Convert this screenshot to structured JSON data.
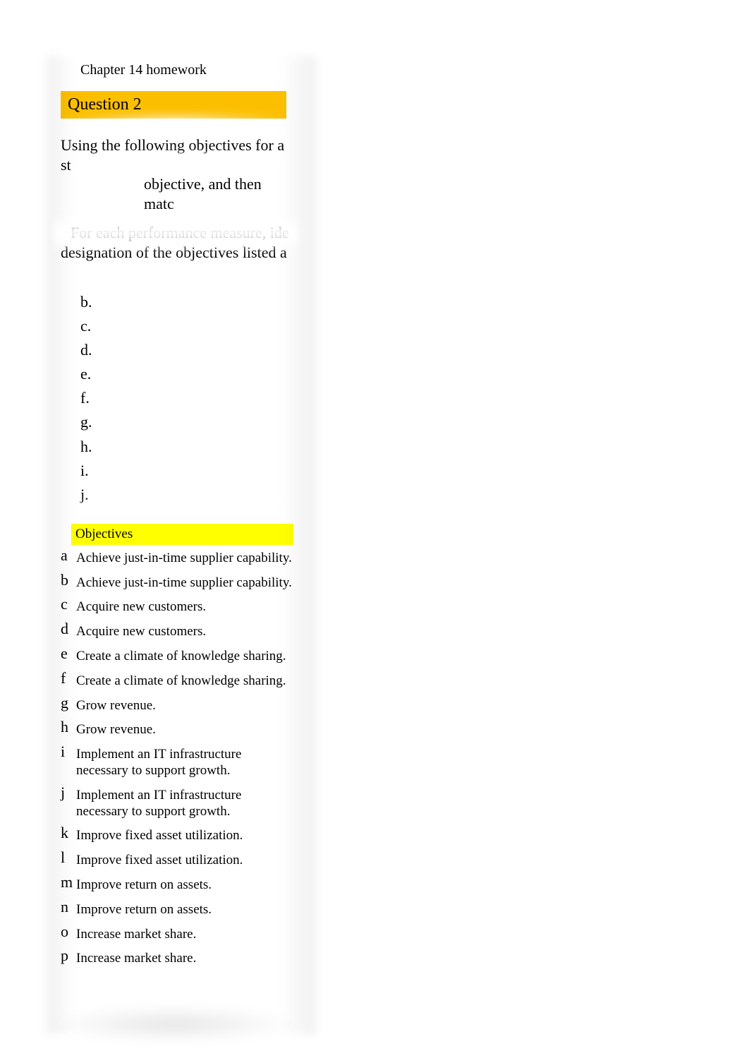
{
  "header": {
    "chapter_title": "Chapter 14 homework",
    "question_label": "Question 2"
  },
  "intro": {
    "line1a": "Using the following objectives for a st",
    "line1b": "objective, and then matc",
    "line2a": "For each performance measure, ide",
    "line2b": "designation of the objectives listed a"
  },
  "letters": [
    "b.",
    "c.",
    "d.",
    "e.",
    "f.",
    "g.",
    "h.",
    "i.",
    "j."
  ],
  "objectives_header": "Objectives",
  "objectives": [
    {
      "key": "a",
      "text": "Achieve just-in-time supplier capability."
    },
    {
      "key": "b",
      "text": "Achieve just-in-time supplier capability."
    },
    {
      "key": "c",
      "text": "Acquire new customers."
    },
    {
      "key": "d",
      "text": "Acquire new customers."
    },
    {
      "key": "e",
      "text": "Create a climate of knowledge sharing."
    },
    {
      "key": "f",
      "text": "Create a climate of knowledge sharing."
    },
    {
      "key": "g",
      "text": "Grow revenue."
    },
    {
      "key": "h",
      "text": "Grow revenue."
    },
    {
      "key": "i",
      "text": "Implement an IT infrastructure necessary to support growth."
    },
    {
      "key": "j",
      "text": "Implement an IT infrastructure necessary to support growth."
    },
    {
      "key": "k",
      "text": "Improve fixed asset utilization."
    },
    {
      "key": "l",
      "text": "Improve fixed asset utilization."
    },
    {
      "key": "m",
      "text": "Improve return on assets."
    },
    {
      "key": "n",
      "text": "Improve return on assets."
    },
    {
      "key": "o",
      "text": "Increase market share."
    },
    {
      "key": "p",
      "text": "Increase market share."
    }
  ]
}
